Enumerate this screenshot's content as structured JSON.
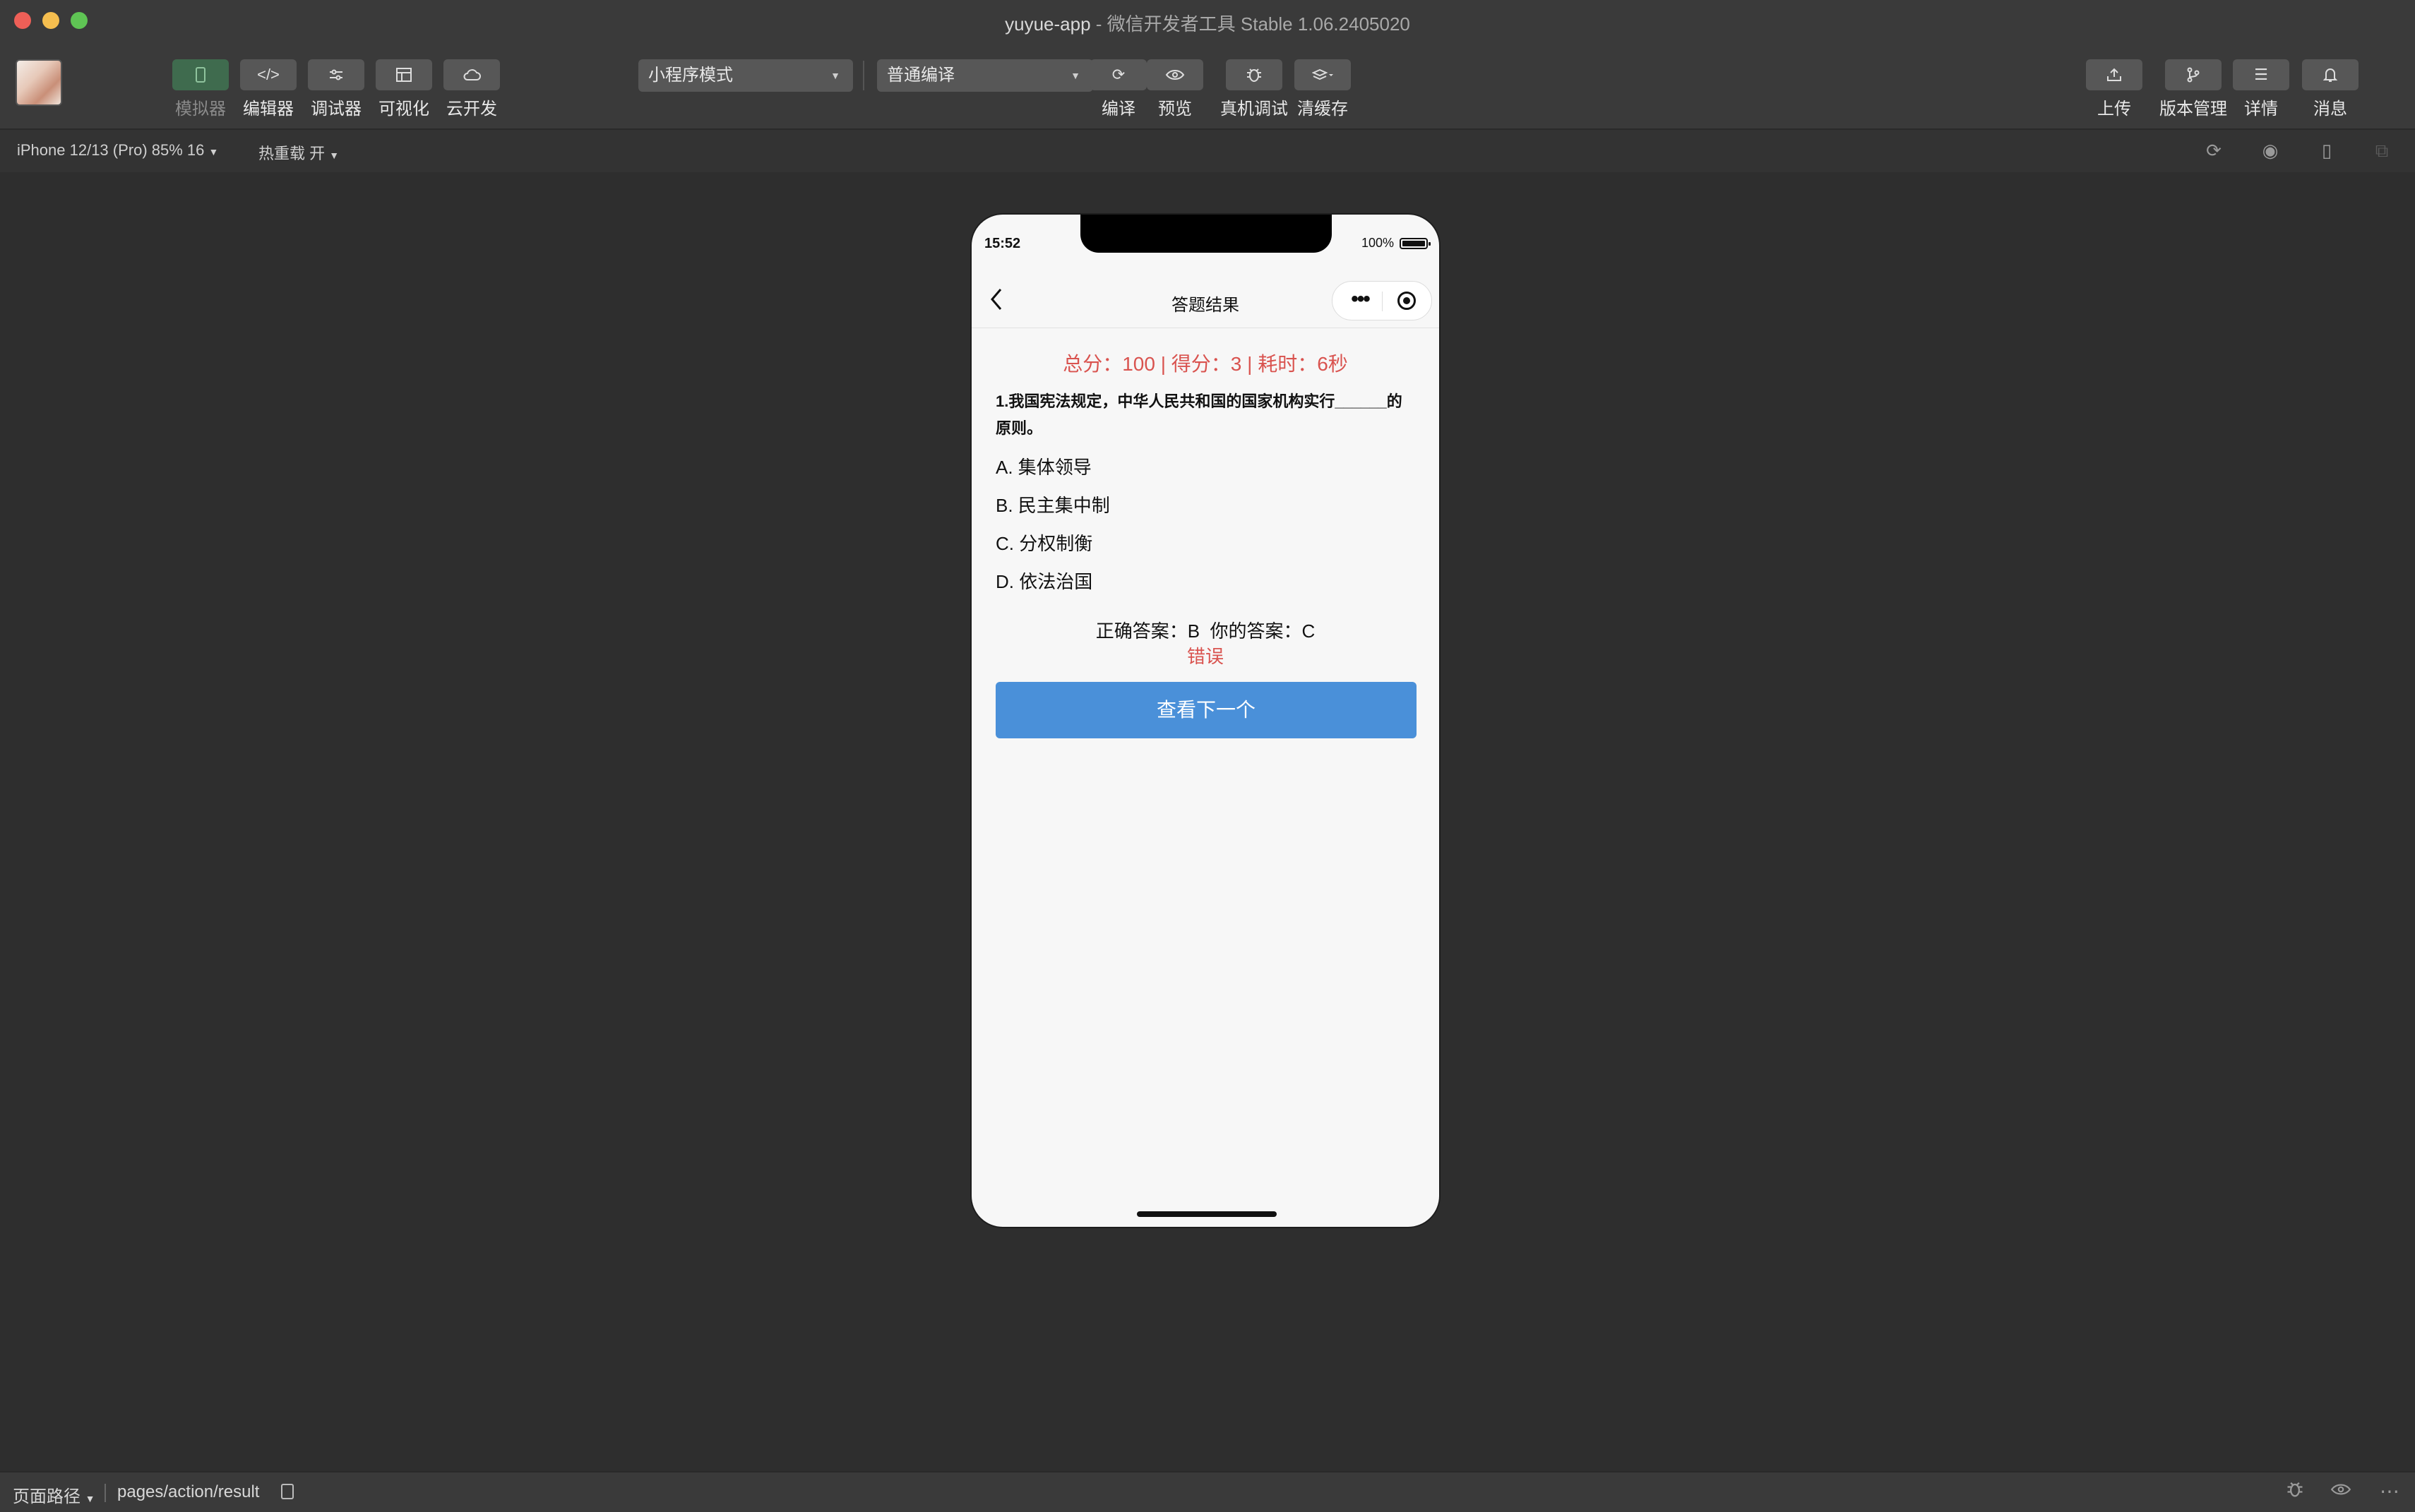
{
  "window": {
    "app_name": "yuyue-app",
    "title_rest": " - 微信开发者工具 Stable 1.06.2405020"
  },
  "toolbar": {
    "left_buttons": [
      {
        "label": "模拟器",
        "icon": "phone-icon"
      },
      {
        "label": "编辑器",
        "icon": "code-icon"
      },
      {
        "label": "调试器",
        "icon": "sliders-icon"
      },
      {
        "label": "可视化",
        "icon": "layout-icon"
      },
      {
        "label": "云开发",
        "icon": "cloud-icon"
      }
    ],
    "mode_select": "小程序模式",
    "compile_select": "普通编译",
    "middle_buttons": [
      {
        "label": "编译",
        "icon": "refresh-icon"
      },
      {
        "label": "预览",
        "icon": "eye-icon"
      },
      {
        "label": "真机调试",
        "icon": "bug-icon"
      },
      {
        "label": "清缓存",
        "icon": "layers-icon"
      }
    ],
    "right_buttons": [
      {
        "label": "上传",
        "icon": "upload-icon"
      },
      {
        "label": "版本管理",
        "icon": "branch-icon"
      },
      {
        "label": "详情",
        "icon": "menu-icon"
      },
      {
        "label": "消息",
        "icon": "bell-icon"
      }
    ]
  },
  "subbar": {
    "device": "iPhone 12/13 (Pro) 85% 16",
    "hot_reload": "热重载 开"
  },
  "phone": {
    "status": {
      "time": "15:52",
      "battery": "100%"
    },
    "nav_title": "答题结果",
    "score_line": "总分：100 | 得分：3 | 耗时：6秒",
    "question": "1.我国宪法规定，中华人民共和国的国家机构实行______的原则。",
    "options": [
      "A. 集体领导",
      "B. 民主集中制",
      "C. 分权制衡",
      "D. 依法治国"
    ],
    "answer_line": "正确答案：B  你的答案：C",
    "verdict": "错误",
    "next_button": "查看下一个"
  },
  "bottombar": {
    "label": "页面路径",
    "path": "pages/action/result"
  },
  "colors": {
    "accent_blue": "#4a90d9",
    "error_red": "#d9534f",
    "active_green": "#3f6b4e"
  }
}
